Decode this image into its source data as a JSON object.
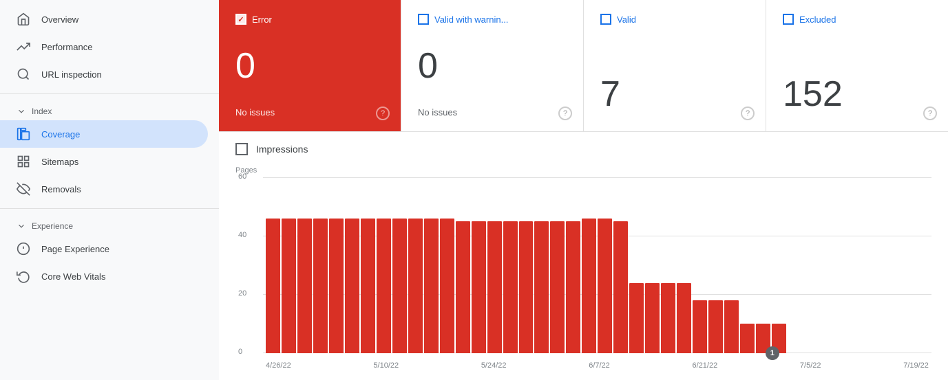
{
  "sidebar": {
    "items": [
      {
        "id": "overview",
        "label": "Overview",
        "icon": "home",
        "active": false
      },
      {
        "id": "performance",
        "label": "Performance",
        "icon": "trending-up",
        "active": false
      },
      {
        "id": "url-inspection",
        "label": "URL inspection",
        "icon": "search",
        "active": false
      }
    ],
    "sections": [
      {
        "label": "Index",
        "items": [
          {
            "id": "coverage",
            "label": "Coverage",
            "icon": "copy",
            "active": true
          },
          {
            "id": "sitemaps",
            "label": "Sitemaps",
            "icon": "grid",
            "active": false
          },
          {
            "id": "removals",
            "label": "Removals",
            "icon": "eye-off",
            "active": false
          }
        ]
      },
      {
        "label": "Experience",
        "items": [
          {
            "id": "page-experience",
            "label": "Page Experience",
            "icon": "settings",
            "active": false
          },
          {
            "id": "core-web-vitals",
            "label": "Core Web Vitals",
            "icon": "refresh",
            "active": false
          }
        ]
      }
    ]
  },
  "status_cards": [
    {
      "id": "error",
      "label": "Error",
      "count": "0",
      "sublabel": "No issues",
      "type": "error",
      "checked": true
    },
    {
      "id": "valid-warning",
      "label": "Valid with warnin...",
      "count": "0",
      "sublabel": "No issues",
      "type": "normal"
    },
    {
      "id": "valid",
      "label": "Valid",
      "count": "7",
      "sublabel": "",
      "type": "normal"
    },
    {
      "id": "excluded",
      "label": "Excluded",
      "count": "152",
      "sublabel": "",
      "type": "normal"
    }
  ],
  "chart": {
    "y_label": "Pages",
    "y_ticks": [
      "60",
      "40",
      "20",
      "0"
    ],
    "x_labels": [
      "4/26/22",
      "5/10/22",
      "5/24/22",
      "6/7/22",
      "6/21/22",
      "7/5/22",
      "7/19/22"
    ],
    "dot_label": "1",
    "impressions_label": "Impressions",
    "bars": [
      46,
      46,
      46,
      46,
      46,
      46,
      46,
      46,
      46,
      46,
      46,
      46,
      45,
      45,
      45,
      45,
      45,
      45,
      45,
      45,
      46,
      46,
      45,
      24,
      24,
      24,
      24,
      18,
      18,
      18,
      10,
      10,
      10,
      0,
      0,
      0,
      0,
      0,
      0,
      0,
      0,
      0
    ]
  }
}
